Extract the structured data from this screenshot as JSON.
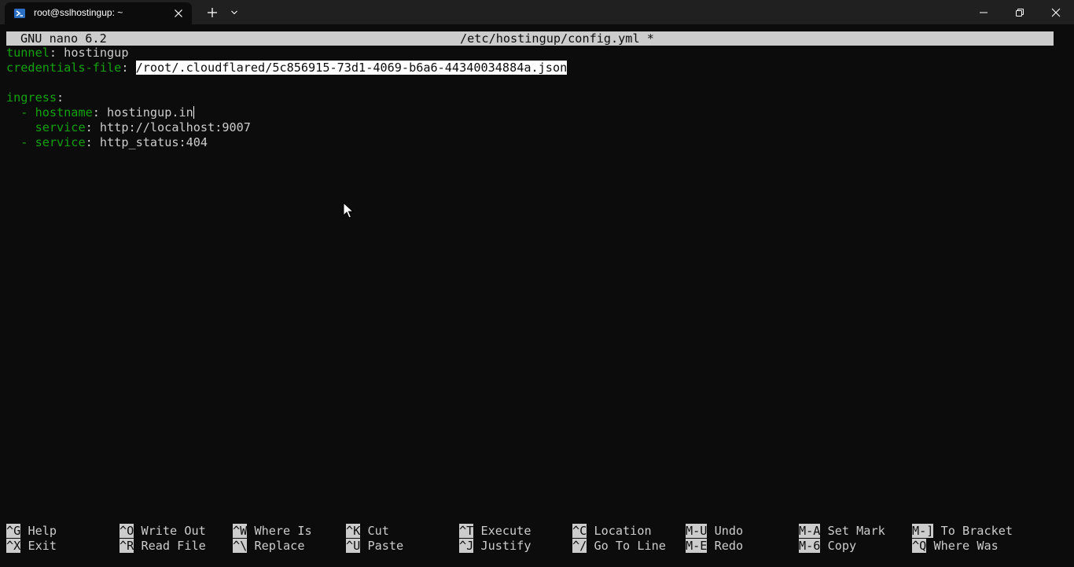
{
  "window": {
    "tab_title": "root@sslhostingup: ~",
    "tab_icon": "powershell-icon",
    "new_tab_icon": "plus-icon",
    "dropdown_icon": "chevron-down-icon",
    "minimize_icon": "minimize-icon",
    "maximize_icon": "restore-icon",
    "close_icon": "close-icon"
  },
  "nano": {
    "version": "GNU nano 6.2",
    "filename": "/etc/hostingup/config.yml *"
  },
  "file": {
    "line1": {
      "key": "tunnel",
      "sep": ": ",
      "value": "hostingup"
    },
    "line2": {
      "key": "credentials-file",
      "sep": ": ",
      "value": "/root/.cloudflared/5c856915-73d1-4069-b6a6-44340034884a.json"
    },
    "line4": {
      "key": "ingress",
      "sep": ":"
    },
    "line5": {
      "indent": "  ",
      "dash": "- ",
      "key": "hostname",
      "sep": ": ",
      "value": "hostingup.in"
    },
    "line6": {
      "indent": "    ",
      "key": "service",
      "sep": ": ",
      "value": "http://localhost:9007"
    },
    "line7": {
      "indent": "  ",
      "dash": "- ",
      "key": "service",
      "sep": ": ",
      "value": "http_status:404"
    }
  },
  "shortcuts": [
    {
      "key": "^G",
      "label": "Help"
    },
    {
      "key": "^X",
      "label": "Exit"
    },
    {
      "key": "^O",
      "label": "Write Out"
    },
    {
      "key": "^R",
      "label": "Read File"
    },
    {
      "key": "^W",
      "label": "Where Is"
    },
    {
      "key": "^\\",
      "label": "Replace"
    },
    {
      "key": "^K",
      "label": "Cut"
    },
    {
      "key": "^U",
      "label": "Paste"
    },
    {
      "key": "^T",
      "label": "Execute"
    },
    {
      "key": "^J",
      "label": "Justify"
    },
    {
      "key": "^C",
      "label": "Location"
    },
    {
      "key": "^/",
      "label": "Go To Line"
    },
    {
      "key": "M-U",
      "label": "Undo"
    },
    {
      "key": "M-E",
      "label": "Redo"
    },
    {
      "key": "M-A",
      "label": "Set Mark"
    },
    {
      "key": "M-6",
      "label": "Copy"
    },
    {
      "key": "M-]",
      "label": "To Bracket"
    },
    {
      "key": "^Q",
      "label": "Where Was"
    }
  ],
  "colors": {
    "background": "#0c0c0c",
    "foreground": "#cccccc",
    "yaml_key": "#13a10e",
    "titlebar": "#202020"
  }
}
